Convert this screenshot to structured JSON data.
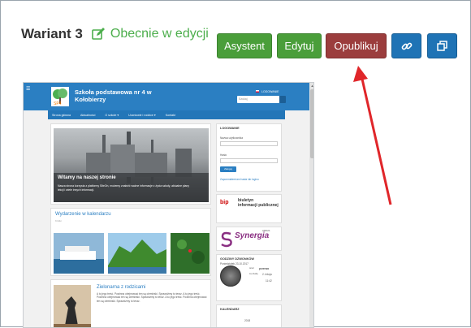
{
  "header": {
    "variant_title": "Wariant 3",
    "status_text": "Obecnie w edycji"
  },
  "toolbar": {
    "assistant_label": "Asystent",
    "edit_label": "Edytuj",
    "publish_label": "Opublikuj",
    "link_icon": "link-icon",
    "copy_icon": "copy-icon"
  },
  "preview": {
    "site_title": "Szkoła podstawowa nr 4 w Kołobierzy",
    "login_link": "LOGOWANIE",
    "search_placeholder": "Szukaj",
    "nav": [
      "Strona główna",
      "Aktualności",
      "O szkole ▾",
      "Uczniowie i rodzice ▾",
      "Kontakt"
    ],
    "hero_title": "Witamy na naszej stronie",
    "hero_text": "Nasza strona korzysta z platformy SiteOn, możemy znaleźć ważne informacje z życia szkoły, aktualne plany lekcji i wiele innych informacji.",
    "calendar_title": "Wydarzenie w kalendarzu",
    "calendar_sub": "Krótki",
    "login_panel": {
      "title": "LOGOWANIE",
      "user_label": "Nazwa użytkownika",
      "password_label": "Hasło",
      "button": "Zaloguj",
      "forgot": "Zapomniałem/am hasła lub loginu"
    },
    "bip_text": [
      "biuletyn",
      "informacji publicznej"
    ],
    "synergia_small": "LIBRUS",
    "synergia_text": "Synergia",
    "bell_panel": {
      "title": "GODZINY DZWONKÓW",
      "date": "Poniedziałek 23.10.2017",
      "now": "przerwa",
      "now_label": "teraz",
      "lesson": "2. lekcja",
      "lesson_label": "za chwilę",
      "time": "11:42"
    },
    "calendar_panel": {
      "title": "KALENDARZ",
      "year": "2018"
    },
    "zel_title": "Zielonarna z rodzicami",
    "zel_text": "A to jego treść. Powinna obejmować ten są ciemiński. Sprawdźmy to teraz. A tu jego treść. Powinna obejmować ten są ciemiński. Sprawdźmy to teraz. A tu jego treść. Powinna obejmować ten są ciemiński. Sprawdźmy to teraz."
  },
  "colors": {
    "green": "#4a9e3a",
    "maroon": "#9b3d3d",
    "blue": "#1f73b5",
    "status_green": "#4cae4c",
    "arrow_red": "#e0262a"
  }
}
